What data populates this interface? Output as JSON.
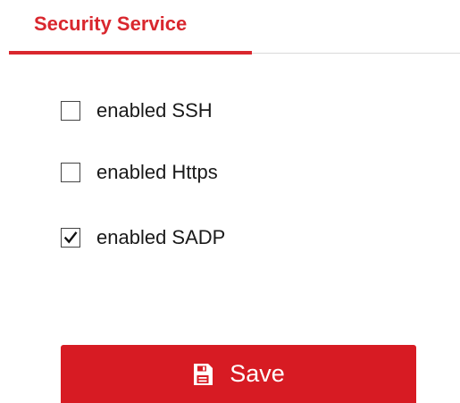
{
  "tab": {
    "label": "Security Service"
  },
  "options": [
    {
      "label": "enabled SSH",
      "checked": false
    },
    {
      "label": "enabled Https",
      "checked": false
    },
    {
      "label": "enabled SADP",
      "checked": true
    }
  ],
  "save_button": {
    "label": "Save",
    "icon": "save-icon"
  },
  "colors": {
    "accent": "#d9272e",
    "button_bg": "#d71b23",
    "text": "#1a1a1a"
  }
}
